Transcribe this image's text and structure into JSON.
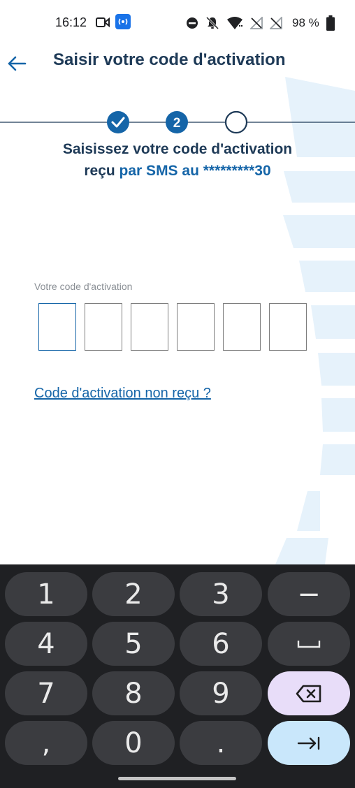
{
  "status_bar": {
    "time": "16:12",
    "battery": "98 %"
  },
  "app_bar": {
    "title": "Saisir votre code d'activation",
    "back_icon": "arrow-left-icon"
  },
  "stepper": {
    "steps": [
      {
        "state": "done",
        "label": ""
      },
      {
        "state": "current",
        "label": "2"
      },
      {
        "state": "pending",
        "label": ""
      }
    ]
  },
  "instructions": {
    "line1": "Saisissez votre code d'activation",
    "line2_prefix": "reçu ",
    "line2_highlight": "par SMS au *********30"
  },
  "code_entry": {
    "label": "Votre code d'activation",
    "digits": [
      "",
      "",
      "",
      "",
      "",
      ""
    ]
  },
  "resend_link": "Code d'activation non reçu ?",
  "keyboard": {
    "rows": [
      [
        "1",
        "2",
        "3",
        "−"
      ],
      [
        "4",
        "5",
        "6",
        "␣"
      ],
      [
        "7",
        "8",
        "9",
        "⌫"
      ],
      [
        ",",
        "0",
        ".",
        "→|"
      ]
    ]
  },
  "colors": {
    "primary": "#1565a8",
    "title": "#1e3a57",
    "accent_stripes": "#e6f2fb"
  }
}
